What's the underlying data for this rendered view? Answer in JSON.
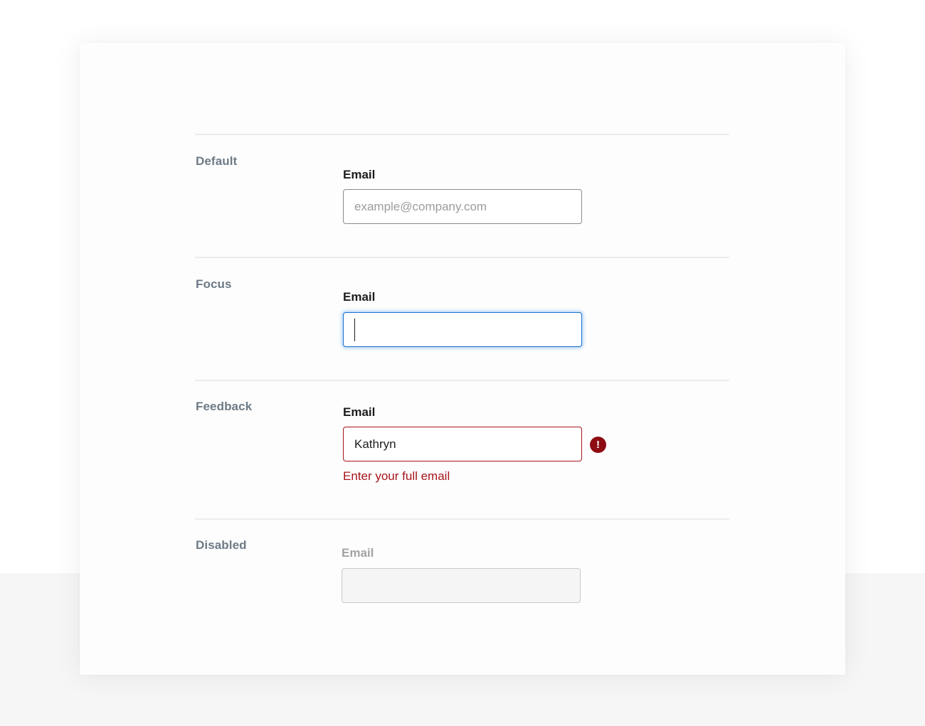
{
  "states": {
    "default": {
      "label": "Default",
      "field_label": "Email",
      "placeholder": "example@company.com",
      "value": ""
    },
    "focus": {
      "label": "Focus",
      "field_label": "Email",
      "value": ""
    },
    "feedback": {
      "label": "Feedback",
      "field_label": "Email",
      "value": "Kathryn",
      "error_icon": "!",
      "error_message": "Enter your full email"
    },
    "disabled": {
      "label": "Disabled",
      "field_label": "Email",
      "value": ""
    }
  },
  "icons": {
    "error": "exclamation-circle-icon"
  },
  "colors": {
    "state_label": "#6d7a86",
    "focus_border": "#1a6fcf",
    "error": "#a8141b",
    "error_icon_bg": "#8e0b12",
    "disabled_text": "#a3a3a3",
    "disabled_bg": "#f5f5f5"
  }
}
